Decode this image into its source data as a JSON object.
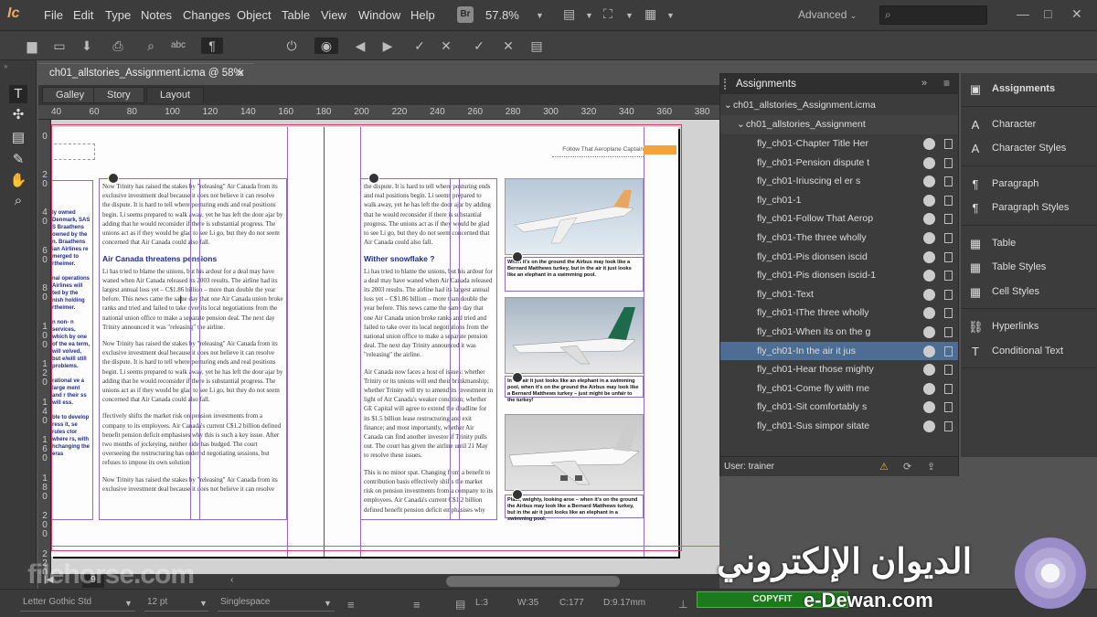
{
  "app": {
    "logo": "Ic"
  },
  "menu": [
    "File",
    "Edit",
    "Type",
    "Notes",
    "Changes",
    "Object",
    "Table",
    "View",
    "Window",
    "Help"
  ],
  "header": {
    "br": "Br",
    "zoom": "57.8%",
    "workspace": "Advanced",
    "search_placeholder": ""
  },
  "document": {
    "tab_title": "ch01_allstories_Assignment.icma @ 58%",
    "view_tabs": [
      "Galley",
      "Story",
      "Layout"
    ],
    "active_view": "Layout",
    "ruler_h": [
      "40",
      "60",
      "80",
      "100",
      "120",
      "140",
      "160",
      "180",
      "200",
      "220",
      "240",
      "260",
      "280",
      "300",
      "320",
      "340",
      "360",
      "380"
    ],
    "ruler_v": [
      "0",
      "2 0",
      "4 0",
      "6 0",
      "8 0",
      "1 0 0",
      "1 2 0",
      "1 4 0",
      "1 6 0",
      "1 8 0",
      "2 0 0",
      "2 2 0"
    ],
    "header_text": "Follow That Aeroplane Captain",
    "left_col": [
      "Now Trinity has raised the stakes by \"releasing\" Air Canada from its exclusive investment deal because it does not believe it can resolve the dispute. It is hard to tell where posturing ends and real positions begin. Li seems prepared to walk away, yet he has left the door ajar by adding that he would reconsider if there is substantial progress. The unions act as if they would be glad to see Li go, but they do not seem concerned that Air Canada could also fall.",
      "Li has tried to blame the unions, but his ardour for a deal may have waned when Air Canada released its 2003 results. The airline had its largest annual loss yet – C$1.86 billion – more than double the year before. This news came the same day that one Air Canada union broke ranks and tried and failed to take over its local negotiations from the national union office to make a separate pension deal. The next day Trinity announced it was \"releasing\" the airline.",
      "Now Trinity has raised the stakes by \"releasing\" Air Canada from its exclusive investment deal because it does not believe it can resolve the dispute. It is hard to tell where posturing ends and real positions begin. Li seems prepared to walk away, yet he has left the door ajar by adding that he would reconsider if there is substantial progress. The unions act as if they would be glad to see Li go, but they do not seem concerned that Air Canada could also fall.",
      "ffectively shifts the market risk on pension investments from a company to its employees. Air Canada's current C$1.2 billion defined benefit pension deficit emphasises why this is such a key issue. After two months of jockeying, neither side has budged. The court overseeing the restructuring has ordered negotiating sessions, but refuses to impose its own solution.",
      "Now Trinity has raised the stakes by \"releasing\" Air Canada from its exclusive investment deal because it does not believe it can resolve"
    ],
    "left_heading": "Air Canada threatens pensions",
    "right_col": [
      "the dispute. It is hard to tell where posturing ends and real positions begin. Li seems prepared to walk away, yet he has left the door ajar by adding that he would reconsider if there is substantial progress. The unions act as if they would be glad to see Li go, but they do not seem concerned that Air Canada could also fall.",
      "Li has tried to blame the unions, but his ardour for a deal may have waned when Air Canada released its 2003 results. The airline had its largest annual loss yet – C$1.86 billion – more than double the year before. This news came the same day that one Air Canada union broke ranks and tried and failed to take over its local negotiations from the national union office to make a separate pension deal. The next day Trinity announced it was \"releasing\" the airline.",
      "Air Canada now faces a host of issues: whether Trinity or its unions will end their brinkmanship; whether Trinity will try to amend its investment in light of Air Canada's weaker condition; whether GE Capital will agree to extend the deadline for its $1.5 billion lease restructuring and exit finance; and most importantly, whether Air Canada can find another investor if Trinity pulls out. The court has given the airline until 21 May to resolve these issues.",
      "This is no minor spat. Changing from a benefit to contribution basis effectively shifts the market risk on pension investments from a company to its employees. Air Canada's current C$1.2 billion defined benefit pension deficit emphasises why"
    ],
    "right_heading": "Wither snowflake ?",
    "left_sidebar": "ly owned Denmark, SAS S Braathens owned by the n. Braathens ian Airlines re merged to rtheimer.\n\nnal operations Airlines will ted by the nish holding rtheimer.\n\nn non- n services, which by one of the ea term, will volved, but e/will still problems.\n\nrational ve a large ment and r their ss will ess.\n\nble to develop ress it, se rules ctor where rs, with hchanging the eras",
    "captions": [
      "When it's on the ground the Airbus may look like a Bernard Matthews turkey, but in the air it just looks like an elephant in a swimming pool.",
      "In the air it just looks like an elephant in a swimming pool, when it's on the ground the Airbus may look like a Bernard Matthews turkey – just might be unfair to the turkey!",
      "Plain, weighty, looking aroe – when it's on the ground the Airbus may look like a Bernard Matthews turkey, but in the air it just looks like an elephant in a swimming pool."
    ]
  },
  "assignments": {
    "title": "Assignments",
    "file": "ch01_allstories_Assignment.icma",
    "group": "ch01_allstories_Assignment",
    "items": [
      "fly_ch01-Chapter Title Her",
      "fly_ch01-Pension dispute t",
      "fly_ch01-Iriuscing el er s",
      "fly_ch01-1",
      "fly_ch01-Follow That Aerop",
      "fly_ch01-The three wholly",
      "fly_ch01-Pis dionsen iscid",
      "fly_ch01-Pis dionsen iscid-1",
      "fly_ch01-Text",
      "fly_ch01-IThe three wholly",
      "fly_ch01-When its on the g",
      "fly_ch01-In the air it jus",
      "fly_ch01-Hear those mighty",
      "fly_ch01-Come fly with me",
      "fly_ch01-Sit comfortably s",
      "fly_ch01-Sus simpor sitate"
    ],
    "selected_index": 11,
    "user": "User: trainer"
  },
  "right_panel": {
    "groups": [
      [
        {
          "icon": "assignments-icon",
          "glyph": "▣",
          "label": "Assignments"
        }
      ],
      [
        {
          "icon": "character-icon",
          "glyph": "A",
          "label": "Character"
        },
        {
          "icon": "character-styles-icon",
          "glyph": "A",
          "label": "Character Styles"
        }
      ],
      [
        {
          "icon": "paragraph-icon",
          "glyph": "¶",
          "label": "Paragraph"
        },
        {
          "icon": "paragraph-styles-icon",
          "glyph": "¶",
          "label": "Paragraph Styles"
        }
      ],
      [
        {
          "icon": "table-icon",
          "glyph": "▦",
          "label": "Table"
        },
        {
          "icon": "table-styles-icon",
          "glyph": "▦",
          "label": "Table Styles"
        },
        {
          "icon": "cell-styles-icon",
          "glyph": "▦",
          "label": "Cell Styles"
        }
      ],
      [
        {
          "icon": "hyperlinks-icon",
          "glyph": "⛓",
          "label": "Hyperlinks"
        },
        {
          "icon": "conditional-text-icon",
          "glyph": "T",
          "label": "Conditional Text"
        }
      ]
    ]
  },
  "nav": {
    "page": "9"
  },
  "status": {
    "font": "Letter Gothic Std",
    "size": "12 pt",
    "spacing": "Singlespace",
    "line": "L:3",
    "words": "W:35",
    "chars": "C:177",
    "depth": "D:9.17mm",
    "copyfit": "COPYFIT"
  },
  "watermarks": {
    "arabic": "الديوان الإلكتروني",
    "site": "e-Dewan.com",
    "filehorse": "filehorse.com"
  },
  "colors": {
    "selected_row": "#4d6d92",
    "copyfit": "#1b7a1b",
    "frame": "#8d6ad6",
    "bleed": "#d33b6a",
    "heading": "#1e2c8c"
  }
}
